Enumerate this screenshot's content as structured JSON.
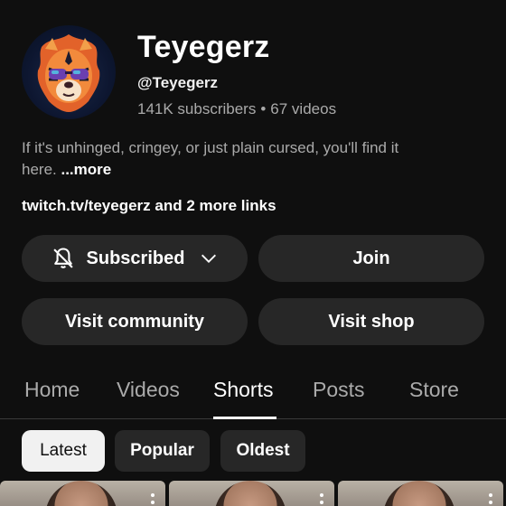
{
  "channel": {
    "name": "Teyegerz",
    "handle": "@Teyegerz",
    "subscribers": "141K subscribers",
    "separator": "•",
    "videos": "67 videos",
    "avatar_icon": "tiger-avatar-icon"
  },
  "description": {
    "text": "If it's unhinged, cringey, or just plain cursed, you'll find it here.",
    "more": "...more"
  },
  "links": "twitch.tv/teyegerz and 2 more links",
  "buttons": {
    "subscribed": "Subscribed",
    "join": "Join",
    "community": "Visit community",
    "shop": "Visit shop"
  },
  "tabs": [
    {
      "label": "Home"
    },
    {
      "label": "Videos"
    },
    {
      "label": "Shorts",
      "active": true
    },
    {
      "label": "Posts"
    },
    {
      "label": "Store"
    }
  ],
  "filters": [
    {
      "label": "Latest",
      "selected": true
    },
    {
      "label": "Popular"
    },
    {
      "label": "Oldest"
    }
  ],
  "colors": {
    "background": "#0f0f0f",
    "button_bg": "#272727",
    "secondary_text": "#aaaaaa"
  }
}
